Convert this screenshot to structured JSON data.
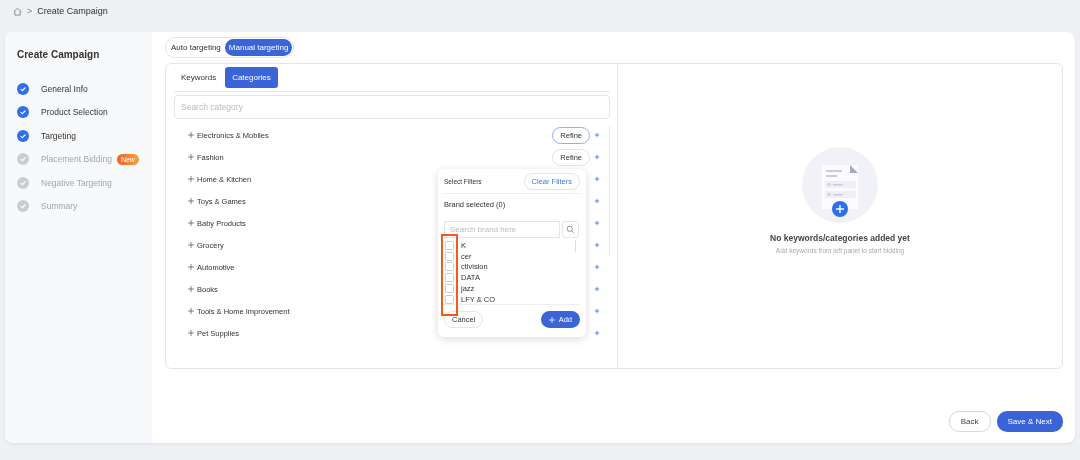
{
  "breadcrumb": {
    "separator": ">",
    "current": "Create Campaign"
  },
  "sidebar": {
    "title": "Create Campaign",
    "steps": [
      {
        "label": "General Info",
        "completed": true
      },
      {
        "label": "Product Selection",
        "completed": true
      },
      {
        "label": "Targeting",
        "completed": true
      },
      {
        "label": "Placement Bidding",
        "completed": false,
        "badge": "New"
      },
      {
        "label": "Negative Targeting",
        "completed": false
      },
      {
        "label": "Summary",
        "completed": false
      }
    ]
  },
  "targeting_toggle": [
    {
      "label": "Auto targeting",
      "selected": false
    },
    {
      "label": "Manual targeting",
      "selected": true
    }
  ],
  "tabs": [
    {
      "label": "Keywords",
      "selected": false
    },
    {
      "label": "Categories",
      "selected": true
    }
  ],
  "search": {
    "placeholder": "Search category"
  },
  "categories": [
    {
      "label": "Electronics & Mobiles",
      "refine": "Refine",
      "focused": true
    },
    {
      "label": "Fashion",
      "refine": "Refine",
      "focused": false
    },
    {
      "label": "Home & Kitchen"
    },
    {
      "label": "Toys & Games"
    },
    {
      "label": "Baby Products"
    },
    {
      "label": "Grocery"
    },
    {
      "label": "Automotive"
    },
    {
      "label": "Books"
    },
    {
      "label": "Tools & Home Improvement"
    },
    {
      "label": "Pet Supplies"
    }
  ],
  "filter_popup": {
    "title": "Select Filters",
    "clear": "Clear Filters",
    "selected_count": "Brand selected (0)",
    "search_placeholder": "Search brand here",
    "brands": [
      {
        "label": "K",
        "checked": false
      },
      {
        "label": "cer",
        "checked": false
      },
      {
        "label": "ctivision",
        "checked": false
      },
      {
        "label": "DATA",
        "checked": false
      },
      {
        "label": "jazz",
        "checked": false
      },
      {
        "label": "LFY & CO",
        "checked": false
      }
    ],
    "cancel": "Cancel",
    "add": "Add"
  },
  "empty_state": {
    "title": "No keywords/categories added yet",
    "subtitle": "Add keywords from left panel to start bidding"
  },
  "footer": {
    "back": "Back",
    "next": "Save & Next"
  }
}
